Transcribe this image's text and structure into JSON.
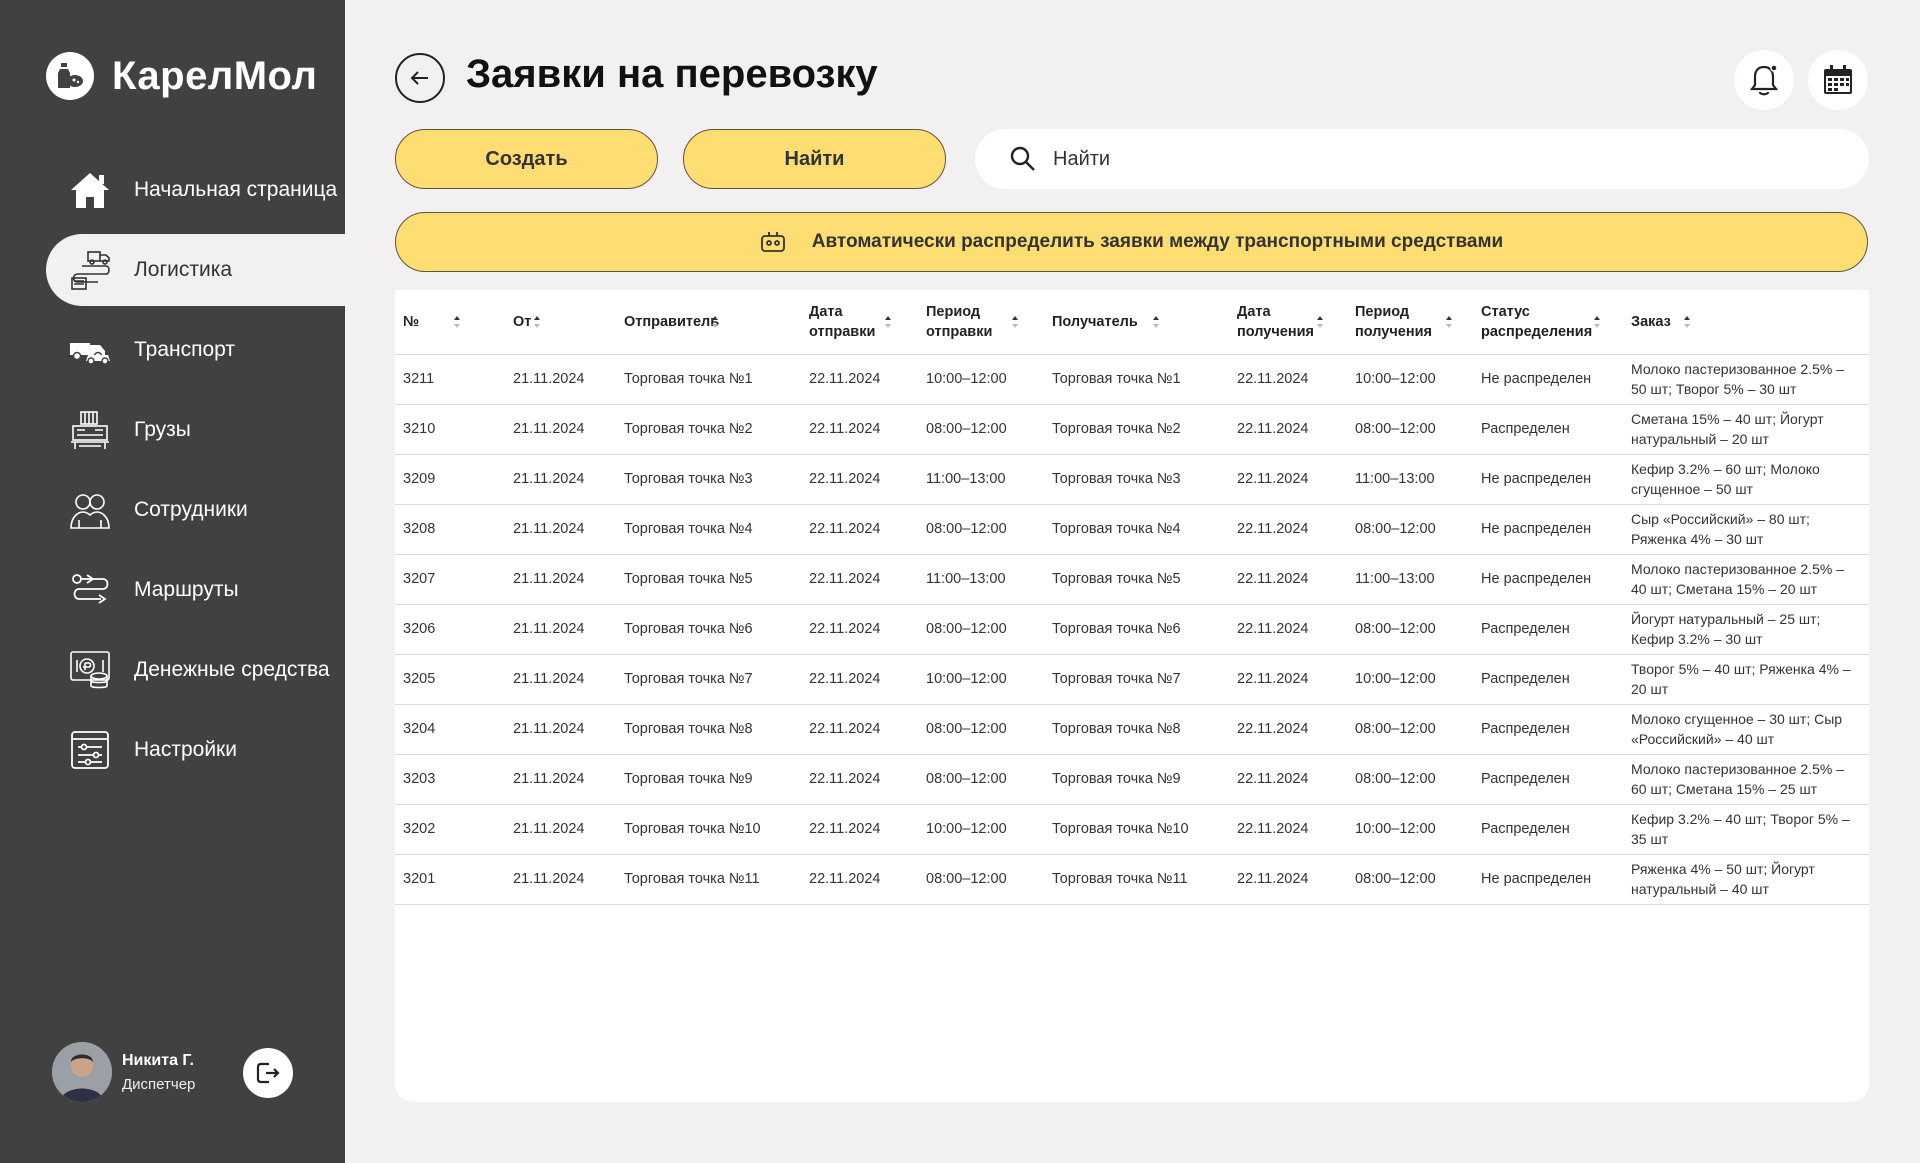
{
  "app": {
    "brand": "КарелМол"
  },
  "sidebar": {
    "items": [
      {
        "label": "Начальная страница",
        "icon": "home-icon"
      },
      {
        "label": "Логистика",
        "icon": "logistics-icon"
      },
      {
        "label": "Транспорт",
        "icon": "truck-icon"
      },
      {
        "label": "Грузы",
        "icon": "cargo-icon"
      },
      {
        "label": "Сотрудники",
        "icon": "employees-icon"
      },
      {
        "label": "Маршруты",
        "icon": "routes-icon"
      },
      {
        "label": "Денежные средства",
        "icon": "money-icon"
      },
      {
        "label": "Настройки",
        "icon": "settings-icon"
      }
    ],
    "active_index": 1
  },
  "user": {
    "name": "Никита Г.",
    "role": "Диспетчер"
  },
  "header": {
    "title": "Заявки на перевозку"
  },
  "toolbar": {
    "create_label": "Создать",
    "find_label": "Найти",
    "search_placeholder": "Найти",
    "auto_distribute_label": "Автоматически распределить заявки между транспортными средствами"
  },
  "colors": {
    "sidebar": "#414141",
    "accent": "#fedd72",
    "background": "#f3f0f1"
  },
  "table": {
    "columns": [
      {
        "label": "№",
        "line2": ""
      },
      {
        "label": "От",
        "line2": ""
      },
      {
        "label": "Отправитель",
        "line2": ""
      },
      {
        "label": "Дата",
        "line2": "отправки"
      },
      {
        "label": "Период",
        "line2": "отправки"
      },
      {
        "label": "Получатель",
        "line2": ""
      },
      {
        "label": "Дата",
        "line2": "получения"
      },
      {
        "label": "Период",
        "line2": "получения"
      },
      {
        "label": "Статус",
        "line2": "распределения"
      },
      {
        "label": "Заказ",
        "line2": ""
      }
    ],
    "rows": [
      [
        "3211",
        "21.11.2024",
        "Торговая точка №1",
        "22.11.2024",
        "10:00–12:00",
        "Торговая точка №1",
        "22.11.2024",
        "10:00–12:00",
        "Не распределен",
        "Молоко пастеризованное 2.5% – 50 шт; Творог 5% – 30 шт"
      ],
      [
        "3210",
        "21.11.2024",
        "Торговая точка №2",
        "22.11.2024",
        "08:00–12:00",
        "Торговая точка №2",
        "22.11.2024",
        "08:00–12:00",
        "Распределен",
        "Сметана 15% – 40 шт; Йогурт натуральный – 20 шт"
      ],
      [
        "3209",
        "21.11.2024",
        "Торговая точка №3",
        "22.11.2024",
        "11:00–13:00",
        "Торговая точка №3",
        "22.11.2024",
        "11:00–13:00",
        "Не распределен",
        "Кефир 3.2% – 60 шт; Молоко сгущенное – 50 шт"
      ],
      [
        "3208",
        "21.11.2024",
        "Торговая точка №4",
        "22.11.2024",
        "08:00–12:00",
        "Торговая точка №4",
        "22.11.2024",
        "08:00–12:00",
        "Не распределен",
        "Сыр «Российский» – 80 шт; Ряженка 4% – 30 шт"
      ],
      [
        "3207",
        "21.11.2024",
        "Торговая точка №5",
        "22.11.2024",
        "11:00–13:00",
        "Торговая точка №5",
        "22.11.2024",
        "11:00–13:00",
        "Не распределен",
        "Молоко пастеризованное 2.5% – 40 шт; Сметана 15% – 20 шт"
      ],
      [
        "3206",
        "21.11.2024",
        "Торговая точка №6",
        "22.11.2024",
        "08:00–12:00",
        "Торговая точка №6",
        "22.11.2024",
        "08:00–12:00",
        "Распределен",
        "Йогурт натуральный – 25 шт; Кефир 3.2% – 30 шт"
      ],
      [
        "3205",
        "21.11.2024",
        "Торговая точка №7",
        "22.11.2024",
        "10:00–12:00",
        "Торговая точка №7",
        "22.11.2024",
        "10:00–12:00",
        "Распределен",
        "Творог 5% – 40 шт; Ряженка 4% – 20 шт"
      ],
      [
        "3204",
        "21.11.2024",
        "Торговая точка №8",
        "22.11.2024",
        "08:00–12:00",
        "Торговая точка №8",
        "22.11.2024",
        "08:00–12:00",
        "Распределен",
        "Молоко сгущенное – 30 шт; Сыр «Российский» – 40 шт"
      ],
      [
        "3203",
        "21.11.2024",
        "Торговая точка №9",
        "22.11.2024",
        "08:00–12:00",
        "Торговая точка №9",
        "22.11.2024",
        "08:00–12:00",
        "Распределен",
        "Молоко пастеризованное 2.5% – 60 шт; Сметана 15% – 25 шт"
      ],
      [
        "3202",
        "21.11.2024",
        "Торговая точка №10",
        "22.11.2024",
        "10:00–12:00",
        "Торговая точка №10",
        "22.11.2024",
        "10:00–12:00",
        "Распределен",
        "Кефир 3.2% – 40 шт; Творог 5% – 35 шт"
      ],
      [
        "3201",
        "21.11.2024",
        "Торговая точка №11",
        "22.11.2024",
        "08:00–12:00",
        "Торговая точка №11",
        "22.11.2024",
        "08:00–12:00",
        "Не распределен",
        "Ряженка 4% – 50 шт; Йогурт натуральный – 40 шт"
      ]
    ]
  }
}
